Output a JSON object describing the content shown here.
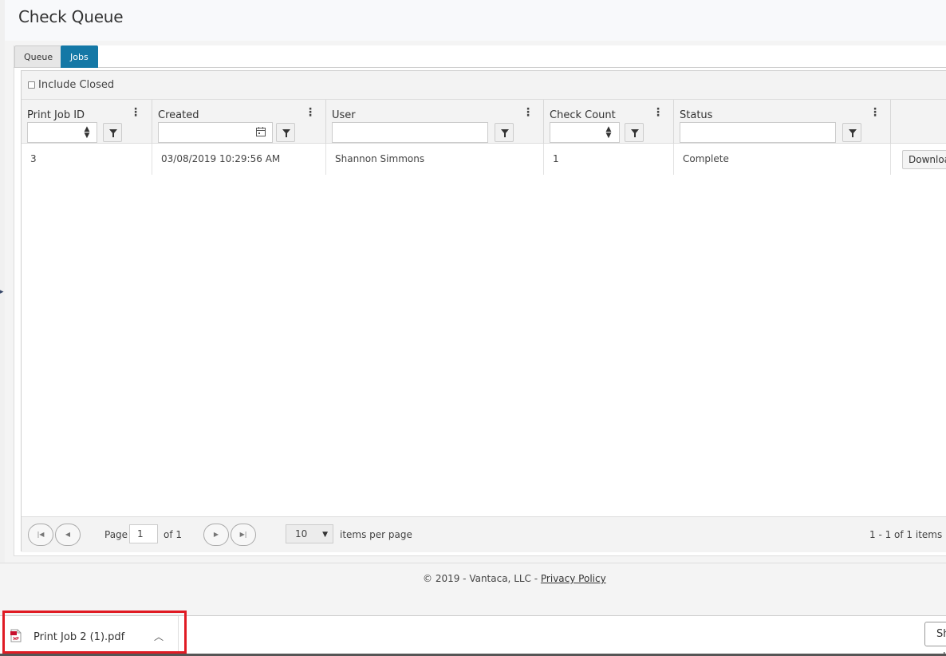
{
  "page": {
    "title": "Check Queue"
  },
  "tabs": [
    {
      "label": "Queue",
      "active": false
    },
    {
      "label": "Jobs",
      "active": true
    }
  ],
  "toolbar": {
    "include_closed_label": "Include Closed",
    "include_closed_checked": false
  },
  "grid": {
    "columns": [
      {
        "title": "Print Job ID"
      },
      {
        "title": "Created"
      },
      {
        "title": "User"
      },
      {
        "title": "Check Count"
      },
      {
        "title": "Status"
      }
    ],
    "rows": [
      {
        "print_job_id": "3",
        "created": "03/08/2019 10:29:56 AM",
        "user": "Shannon Simmons",
        "check_count": "1",
        "status": "Complete",
        "action_label": "Download"
      }
    ]
  },
  "pager": {
    "page_label": "Page",
    "current_page": "1",
    "of_label": "of 1",
    "page_size": "10",
    "items_per_page_label": "items per page",
    "summary": "1 - 1 of 1 items"
  },
  "footer": {
    "copyright": "© 2019 - Vantaca, LLC - ",
    "privacy_link": "Privacy Policy"
  },
  "downloads": {
    "items": [
      {
        "filename": "Print Job 2 (1).pdf"
      }
    ],
    "show_all_label": "Show all"
  },
  "colors": {
    "accent": "#1478a6",
    "highlight": "#e01b24"
  }
}
